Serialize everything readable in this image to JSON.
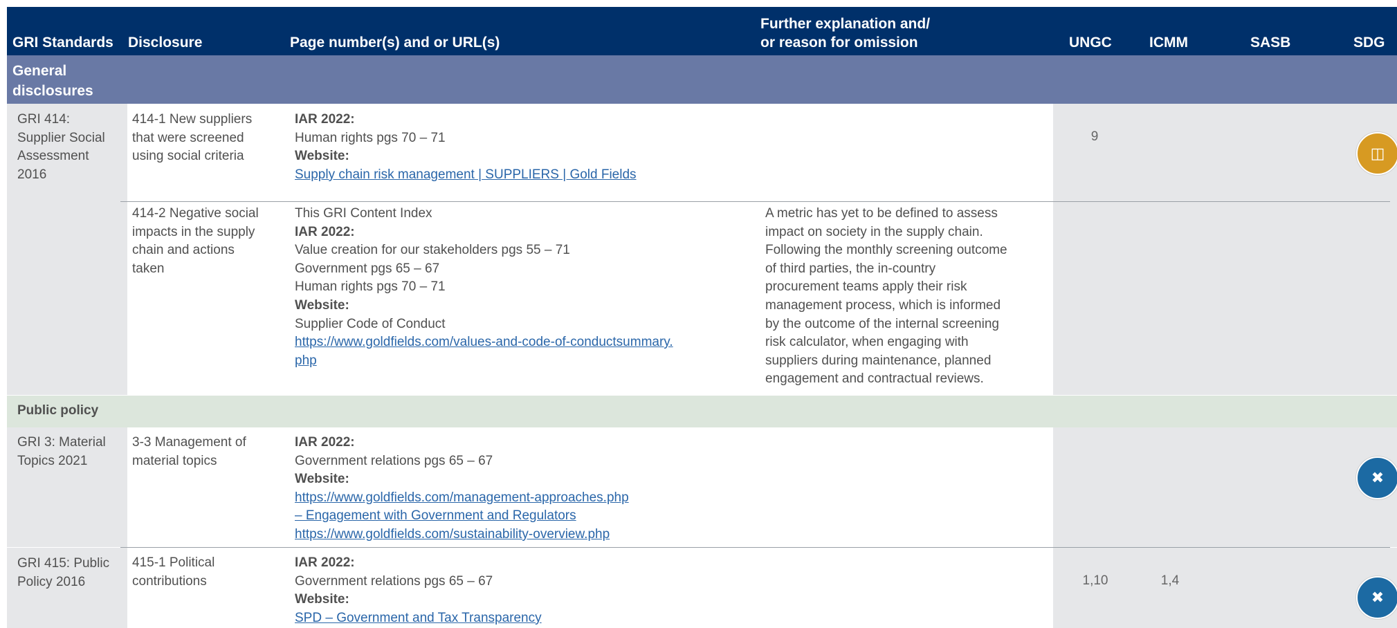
{
  "header": {
    "col_standards": "GRI Standards",
    "col_disclosure": "Disclosure",
    "col_pages": "Page number(s) and or URL(s)",
    "col_explanation_1": "Further explanation and/",
    "col_explanation_2": "or reason for omission",
    "col_ungc": "UNGC",
    "col_icmm": "ICMM",
    "col_sasb": "SASB",
    "col_sdg": "SDG"
  },
  "section_general": {
    "line1": "General",
    "line2": "disclosures"
  },
  "rows": [
    {
      "standard": [
        "GRI 414:",
        "Supplier Social",
        "Assessment",
        "2016"
      ],
      "disclosure": [
        "414-1 New suppliers",
        "that were screened",
        "using social criteria"
      ],
      "pages": {
        "h1": "IAR 2022:",
        "l1": "Human rights pgs 70 – 71",
        "h2": "Website:",
        "link1": "Supply chain risk management | SUPPLIERS | Gold Fields"
      },
      "ungc": "9",
      "sdg_icon": "sdg-gold-icon"
    },
    {
      "disclosure": [
        "414-2 Negative social",
        "impacts in the supply",
        "chain and actions",
        "taken"
      ],
      "pages": {
        "l0": "This GRI Content Index",
        "h1": "IAR 2022:",
        "l1": "Value creation for our stakeholders pgs 55 – 71",
        "l2": "Government pgs 65 – 67",
        "l3": "Human rights pgs 70 – 71",
        "h2": "Website:",
        "l4": "Supplier Code of Conduct",
        "link1": "https://www.goldfields.com/values-and-code-of-conductsummary.",
        "link2": "php"
      },
      "explanation": [
        "A metric has yet to be defined to assess",
        "impact on society in the supply chain.",
        "Following the monthly screening outcome",
        "of third parties, the in-country",
        "procurement teams apply their risk",
        "management process, which is informed",
        "by the outcome of the internal screening",
        "risk calculator, when engaging with",
        "suppliers during maintenance, planned",
        "engagement and contractual reviews."
      ]
    }
  ],
  "section_public": "Public policy",
  "rows2": [
    {
      "standard": [
        "GRI 3: Material",
        "Topics 2021"
      ],
      "disclosure": [
        "3-3 Management of",
        "material topics"
      ],
      "pages": {
        "h1": "IAR 2022:",
        "l1": "Government relations pgs 65 – 67",
        "h2": "Website:",
        "link1": "https://www.goldfields.com/management-approaches.php",
        "link2": "– Engagement with Government and Regulators",
        "link3": "https://www.goldfields.com/sustainability-overview.php"
      },
      "sdg_icon": "sdg-blue-icon"
    },
    {
      "standard": [
        "GRI 415: Public",
        "Policy 2016"
      ],
      "disclosure": [
        "415-1 Political",
        "contributions"
      ],
      "pages": {
        "h1": "IAR 2022:",
        "l1": "Government relations pgs 65 – 67",
        "h2": "Website:",
        "link1": "SPD – Government and Tax Transparency"
      },
      "ungc": "1,10",
      "icmm": "1,4",
      "sdg_icon": "sdg-blue-icon"
    }
  ],
  "colors": {
    "header": "#00306a",
    "section": "#6979a5",
    "public_policy": "#dce6dc",
    "grey_col": "#e6e7e9",
    "link": "#2a66a9"
  }
}
